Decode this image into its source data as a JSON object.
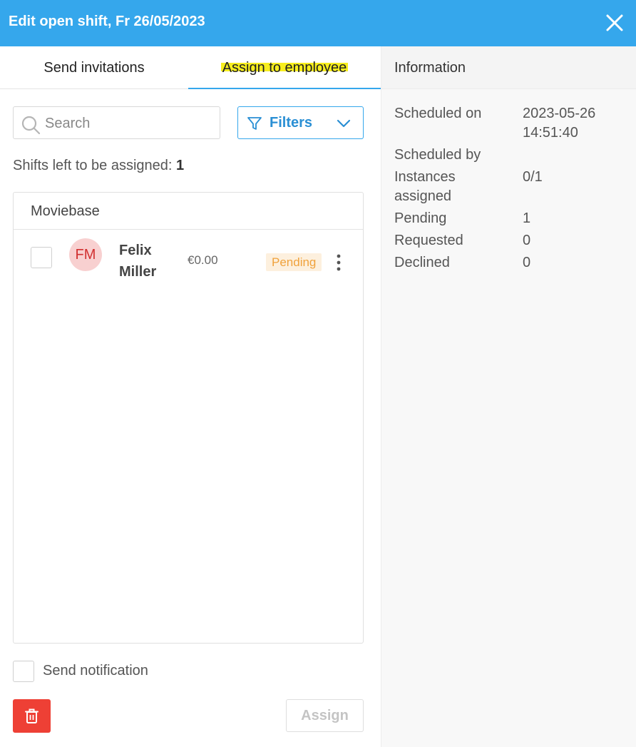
{
  "header": {
    "title": "Edit open shift, Fr 26/05/2023"
  },
  "tabs": {
    "send_invitations": "Send invitations",
    "assign_to_employee": "Assign to employee"
  },
  "search": {
    "placeholder": "Search"
  },
  "filters": {
    "label": "Filters"
  },
  "shifts_left": {
    "label": "Shifts left to be assigned:",
    "count": "1"
  },
  "group": {
    "name": "Moviebase"
  },
  "employees": [
    {
      "initials": "FM",
      "first_name": "Felix",
      "last_name": "Miller",
      "wage": "€0.00",
      "status": "Pending"
    }
  ],
  "footer": {
    "send_notification": "Send notification",
    "assign": "Assign"
  },
  "info": {
    "title": "Information",
    "rows": [
      {
        "label": "Scheduled on",
        "value_line1": "2023-05-26",
        "value_line2": "14:51:40"
      },
      {
        "label": "Scheduled by",
        "value": ""
      },
      {
        "label_line1": "Instances",
        "label_line2": "assigned",
        "value": "0/1"
      },
      {
        "label": "Pending",
        "value": "1"
      },
      {
        "label": "Requested",
        "value": "0"
      },
      {
        "label": "Declined",
        "value": "0"
      }
    ]
  },
  "colors": {
    "header": "#35a7ec",
    "accent": "#35a7ec",
    "danger": "#ee4035",
    "pending": "#f0a23c",
    "highlight": "#f7ee1e"
  },
  "icons": [
    "close-icon",
    "search-icon",
    "filter-icon",
    "chevron-down-icon",
    "more-vertical-icon",
    "trash-icon"
  ]
}
